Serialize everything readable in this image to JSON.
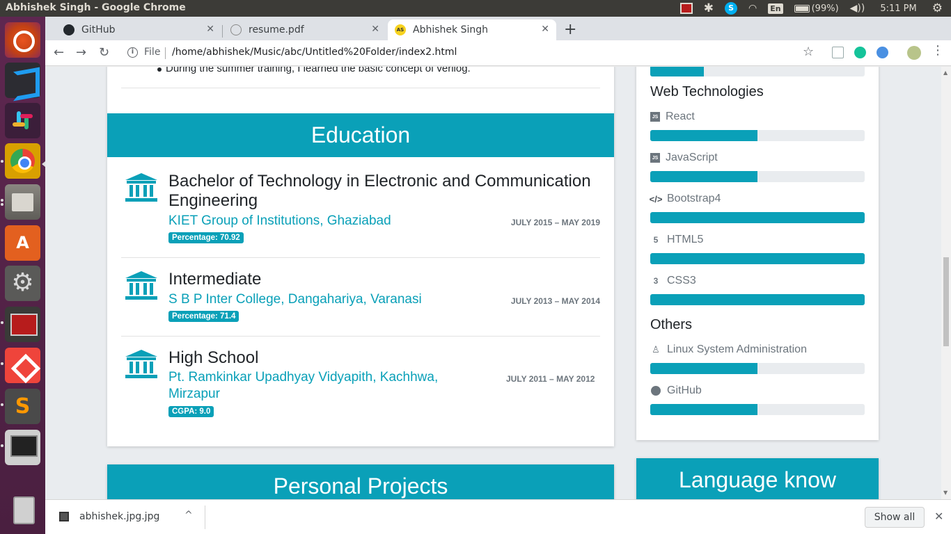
{
  "os": {
    "window_title": "Abhishek Singh - Google Chrome",
    "language": "En",
    "battery": "(99%)",
    "time": "5:11 PM"
  },
  "launcher": {
    "apps": [
      "ubuntu-logo-icon",
      "vscode-icon",
      "slack-icon",
      "chrome-icon",
      "files-icon",
      "software-center-icon",
      "system-settings-icon",
      "terminal-icon",
      "anydesk-icon",
      "sublime-text-icon",
      "display-icon",
      "trash-icon"
    ]
  },
  "browser": {
    "tabs": [
      {
        "label": "GitHub",
        "icon": "github-icon"
      },
      {
        "label": "resume.pdf",
        "icon": "pdf-icon"
      },
      {
        "label": "Abhishek Singh",
        "icon": "as-icon",
        "active": true
      }
    ],
    "new_tab": "+",
    "file_chip": "File",
    "url": "/home/abhishek/Music/abc/Untitled%20Folder/index2.html"
  },
  "page": {
    "training_bullet": "During the summer training, I learned the basic concept of verilog.",
    "education": {
      "heading": "Education",
      "items": [
        {
          "title": "Bachelor of Technology in Electronic and Communication Engineering",
          "institution": "KIET Group of Institutions, Ghaziabad",
          "date": "JULY 2015 – MAY 2019",
          "badge": "Percentage: 70.92"
        },
        {
          "title": "Intermediate",
          "institution": "S B P Inter College, Dangahariya, Varanasi",
          "date": "JULY 2013 – MAY 2014",
          "badge": "Percentage: 71.4"
        },
        {
          "title": "High School",
          "institution": "Pt. Ramkinkar Upadhyay Vidyapith, Kachhwa, Mirzapur",
          "date": "JULY 2011 – MAY 2012",
          "badge": "CGPA: 9.0"
        }
      ]
    },
    "skills": {
      "top_bar_fill": 0.25,
      "web_heading": "Web Technologies",
      "web": [
        {
          "label": "React",
          "icon": "js-icon",
          "level": 0.5
        },
        {
          "label": "JavaScript",
          "icon": "js-icon",
          "level": 0.5
        },
        {
          "label": "Bootstrap4",
          "icon": "code-icon",
          "level": 1.0
        },
        {
          "label": "HTML5",
          "icon": "html5-icon",
          "level": 1.0
        },
        {
          "label": "CSS3",
          "icon": "css3-icon",
          "level": 1.0
        }
      ],
      "others_heading": "Others",
      "others": [
        {
          "label": "Linux System Administration",
          "icon": "linux-icon",
          "level": 0.5
        },
        {
          "label": "GitHub",
          "icon": "github-icon",
          "level": 0.5
        }
      ]
    },
    "projects_heading": "Personal Projects",
    "language_heading": "Language know"
  },
  "downloads": {
    "file": "abhishek.jpg.jpg",
    "show_all": "Show all"
  },
  "colors": {
    "accent": "#0aa0b8",
    "launcher": "#5e2750",
    "os_bar": "#3c3b37"
  }
}
